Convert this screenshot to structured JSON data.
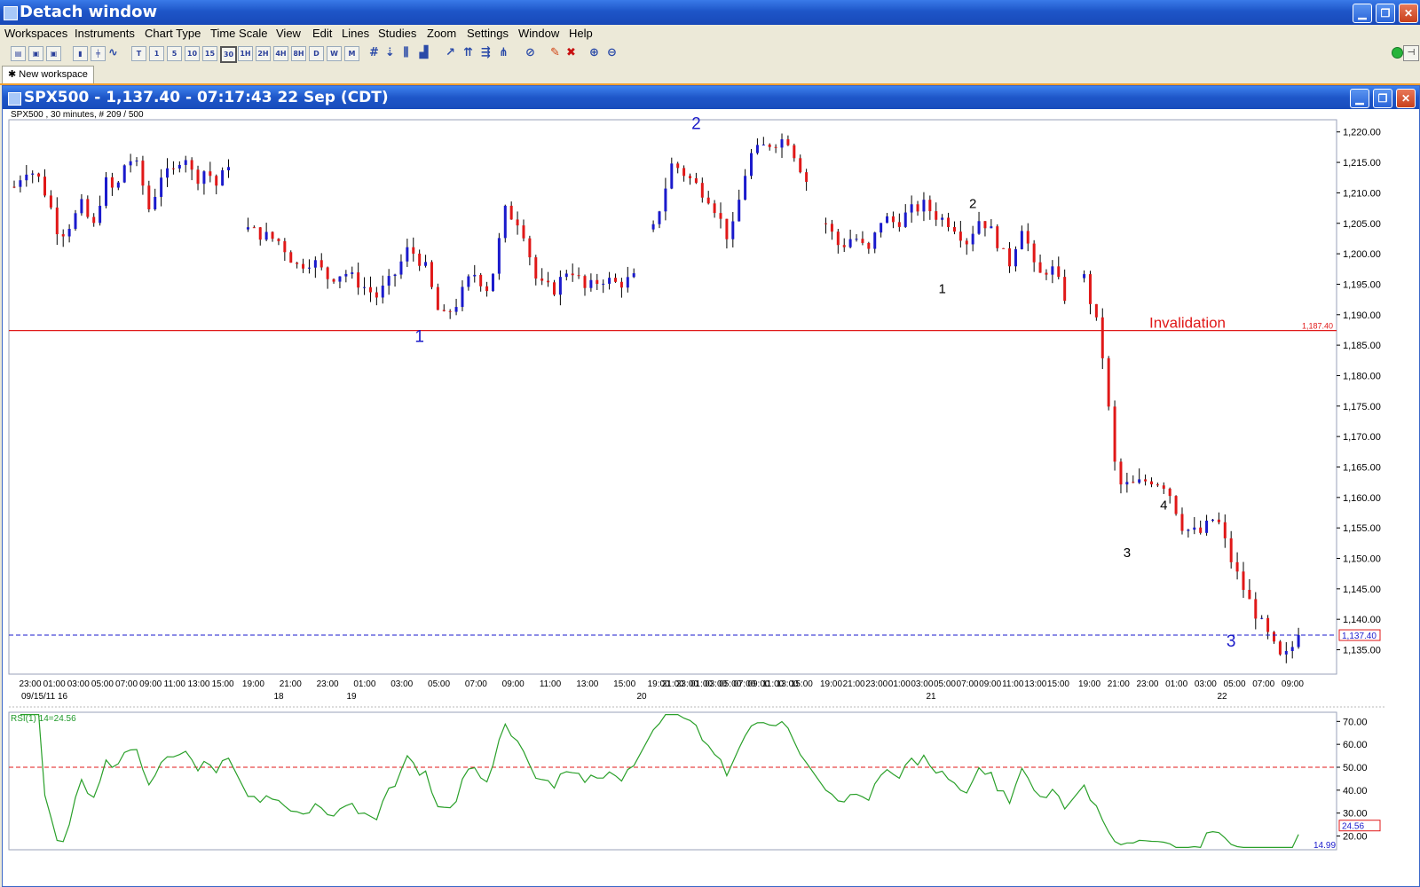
{
  "window": {
    "title": "Detach window",
    "min": "▁",
    "max": "❐",
    "close": "✕"
  },
  "menu": [
    "Workspaces",
    "Instruments",
    "Chart Type",
    "Time Scale",
    "View",
    "Edit",
    "Lines",
    "Studies",
    "Zoom",
    "Settings",
    "Window",
    "Help"
  ],
  "toolbar": {
    "timeframes": [
      "T",
      "1",
      "5",
      "10",
      "15",
      "30",
      "1H",
      "2H",
      "4H",
      "8H",
      "D",
      "W",
      "M"
    ]
  },
  "tab": {
    "label": "New workspace"
  },
  "chart_window": {
    "title": "SPX500 - 1,137.40 - 07:17:43  22 Sep (CDT)"
  },
  "chart_data": {
    "type": "candlestick",
    "info": "SPX500 , 30 minutes, # 209 / 500",
    "ylim": [
      1131,
      1222
    ],
    "yticks": [
      "1,220.00",
      "1,215.00",
      "1,210.00",
      "1,205.00",
      "1,200.00",
      "1,195.00",
      "1,190.00",
      "1,185.00",
      "1,180.00",
      "1,175.00",
      "1,170.00",
      "1,165.00",
      "1,160.00",
      "1,155.00",
      "1,150.00",
      "1,145.00",
      "1,140.00",
      "1,135.00"
    ],
    "ytick_values": [
      1220,
      1215,
      1210,
      1205,
      1200,
      1195,
      1190,
      1185,
      1180,
      1175,
      1170,
      1165,
      1160,
      1155,
      1150,
      1145,
      1140,
      1135
    ],
    "xtick_rows": [
      [
        "23:00",
        "01:00",
        "03:00",
        "05:00",
        "07:00",
        "09:00",
        "11:00",
        "13:00",
        "15:00"
      ],
      [
        "19:00",
        "21:00",
        "23:00",
        "01:00",
        "03:00",
        "05:00",
        "07:00",
        "09:00",
        "11:00",
        "13:00",
        "15:00"
      ],
      [
        "19:00",
        "21:00",
        "23:00",
        "01:00",
        "03:00",
        "05:00",
        "07:00",
        "09:00",
        "11:00",
        "13:00",
        "15:00"
      ],
      [
        "19:00",
        "21:00",
        "23:00",
        "01:00",
        "03:00",
        "05:00",
        "07:00",
        "09:00",
        "11:00",
        "13:00",
        "15:00"
      ],
      [
        "19:00",
        "21:00",
        "23:00",
        "01:00",
        "03:00",
        "05:00",
        "07:00",
        "09:00"
      ]
    ],
    "date_labels": [
      "09/15/11 16",
      "18",
      "19",
      "20",
      "21",
      "22"
    ],
    "invalidation": {
      "label": "Invalidation",
      "price": 1187.4,
      "price_label": "1,187.40"
    },
    "last_price": {
      "value": 1137.4,
      "label": "1,137.40"
    },
    "wave_labels": [
      {
        "text": "1",
        "color": "#1a1ac8",
        "price": 1185.5,
        "idx": 64
      },
      {
        "text": "2",
        "color": "#1a1ac8",
        "price": 1220.5,
        "idx": 107
      },
      {
        "text": "1",
        "color": "#000000",
        "price": 1193.5,
        "idx": 145
      },
      {
        "text": "2",
        "color": "#000000",
        "price": 1207.5,
        "idx": 150
      },
      {
        "text": "3",
        "color": "#000000",
        "price": 1150.2,
        "idx": 173
      },
      {
        "text": "4",
        "color": "#000000",
        "price": 1158,
        "idx": 179
      },
      {
        "text": "3",
        "color": "#1a1ac8",
        "price": 1135.5,
        "idx": 190
      }
    ],
    "segments": [
      {
        "start": 1211,
        "mids": [
          1214,
          1213,
          1209,
          1203,
          1205,
          1208,
          1204,
          1212,
          1210,
          1216,
          1214,
          1207,
          1213,
          1213,
          1217,
          1212,
          1214,
          1211,
          1215
        ],
        "n": 36
      },
      {
        "start": 1204,
        "mids": [
          1203,
          1202,
          1198,
          1199,
          1196,
          1197,
          1195,
          1193,
          1196,
          1201,
          1198,
          1189,
          1192,
          1197,
          1194,
          1207,
          1205,
          1195,
          1194,
          1198,
          1194,
          1196,
          1195,
          1196
        ],
        "n": 64
      },
      {
        "start": 1204,
        "mids": [
          1215,
          1212,
          1209,
          1202,
          1216,
          1218,
          1219,
          1212
        ],
        "n": 26
      },
      {
        "start": 1205,
        "mids": [
          1201,
          1203,
          1200,
          1206,
          1205,
          1207,
          1208,
          1206,
          1205,
          1202,
          1206,
          1203,
          1198,
          1205,
          1196,
          1198,
          1193
        ],
        "n": 40
      },
      {
        "start": 1196,
        "mids": [
          1186,
          1162,
          1162,
          1163,
          1162,
          1155,
          1154,
          1157,
          1149,
          1143,
          1138,
          1133,
          1137
        ],
        "n": 36
      }
    ],
    "rsi": {
      "label": "RSI(1) 14=24.56",
      "ylim": [
        14,
        74
      ],
      "yticks": [
        "70.00",
        "60.00",
        "50.00",
        "40.00",
        "30.00",
        "20.00"
      ],
      "ytick_values": [
        70,
        60,
        50,
        40,
        30,
        20
      ],
      "ref_level": 50,
      "current": "24.56",
      "min_label": "14.99"
    }
  }
}
